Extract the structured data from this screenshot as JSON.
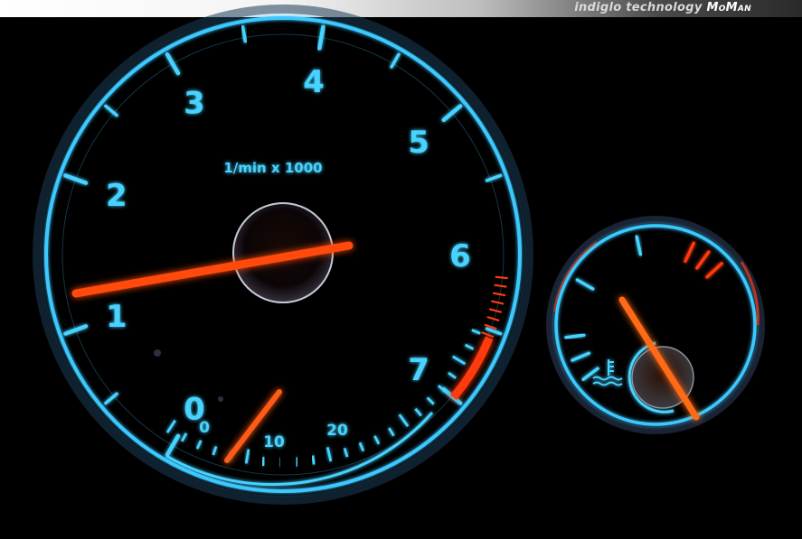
{
  "watermark": {
    "text": "indiglo technology",
    "brand": "MoMan"
  },
  "tachometer": {
    "unit_label": "1/min x 1000",
    "rpm_labels": [
      "0",
      "1",
      "2",
      "3",
      "4",
      "5",
      "6",
      "7"
    ],
    "rpm_needle_value": 1.1,
    "economy_labels": [
      "0",
      "10",
      "20"
    ]
  },
  "temperature_gauge": {
    "icon": "coolant-temperature-icon"
  },
  "colors": {
    "backlight": "#46d2ff",
    "needle": "#ff4a10",
    "redline": "#ff3a10"
  }
}
